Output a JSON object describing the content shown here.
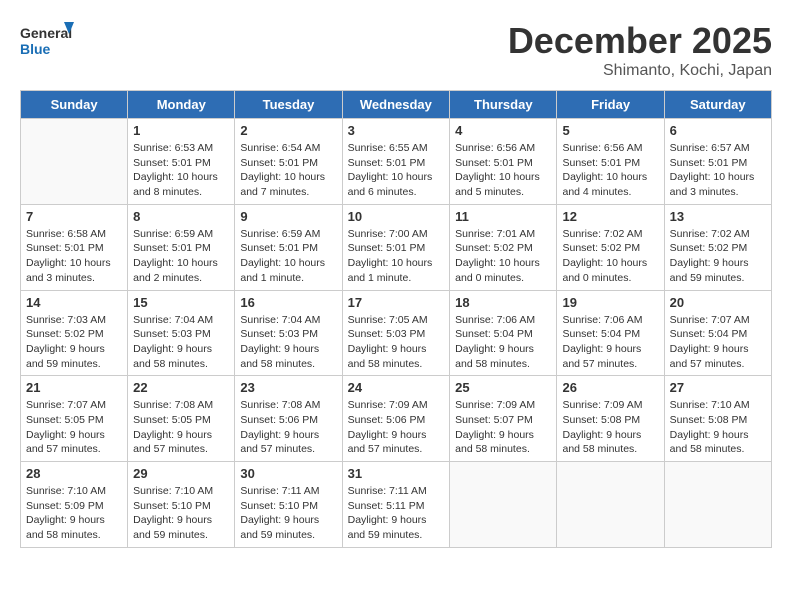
{
  "header": {
    "logo_line1": "General",
    "logo_line2": "Blue",
    "title": "December 2025",
    "subtitle": "Shimanto, Kochi, Japan"
  },
  "weekdays": [
    "Sunday",
    "Monday",
    "Tuesday",
    "Wednesday",
    "Thursday",
    "Friday",
    "Saturday"
  ],
  "weeks": [
    [
      {
        "day": "",
        "text": ""
      },
      {
        "day": "1",
        "text": "Sunrise: 6:53 AM\nSunset: 5:01 PM\nDaylight: 10 hours\nand 8 minutes."
      },
      {
        "day": "2",
        "text": "Sunrise: 6:54 AM\nSunset: 5:01 PM\nDaylight: 10 hours\nand 7 minutes."
      },
      {
        "day": "3",
        "text": "Sunrise: 6:55 AM\nSunset: 5:01 PM\nDaylight: 10 hours\nand 6 minutes."
      },
      {
        "day": "4",
        "text": "Sunrise: 6:56 AM\nSunset: 5:01 PM\nDaylight: 10 hours\nand 5 minutes."
      },
      {
        "day": "5",
        "text": "Sunrise: 6:56 AM\nSunset: 5:01 PM\nDaylight: 10 hours\nand 4 minutes."
      },
      {
        "day": "6",
        "text": "Sunrise: 6:57 AM\nSunset: 5:01 PM\nDaylight: 10 hours\nand 3 minutes."
      }
    ],
    [
      {
        "day": "7",
        "text": "Sunrise: 6:58 AM\nSunset: 5:01 PM\nDaylight: 10 hours\nand 3 minutes."
      },
      {
        "day": "8",
        "text": "Sunrise: 6:59 AM\nSunset: 5:01 PM\nDaylight: 10 hours\nand 2 minutes."
      },
      {
        "day": "9",
        "text": "Sunrise: 6:59 AM\nSunset: 5:01 PM\nDaylight: 10 hours\nand 1 minute."
      },
      {
        "day": "10",
        "text": "Sunrise: 7:00 AM\nSunset: 5:01 PM\nDaylight: 10 hours\nand 1 minute."
      },
      {
        "day": "11",
        "text": "Sunrise: 7:01 AM\nSunset: 5:02 PM\nDaylight: 10 hours\nand 0 minutes."
      },
      {
        "day": "12",
        "text": "Sunrise: 7:02 AM\nSunset: 5:02 PM\nDaylight: 10 hours\nand 0 minutes."
      },
      {
        "day": "13",
        "text": "Sunrise: 7:02 AM\nSunset: 5:02 PM\nDaylight: 9 hours\nand 59 minutes."
      }
    ],
    [
      {
        "day": "14",
        "text": "Sunrise: 7:03 AM\nSunset: 5:02 PM\nDaylight: 9 hours\nand 59 minutes."
      },
      {
        "day": "15",
        "text": "Sunrise: 7:04 AM\nSunset: 5:03 PM\nDaylight: 9 hours\nand 58 minutes."
      },
      {
        "day": "16",
        "text": "Sunrise: 7:04 AM\nSunset: 5:03 PM\nDaylight: 9 hours\nand 58 minutes."
      },
      {
        "day": "17",
        "text": "Sunrise: 7:05 AM\nSunset: 5:03 PM\nDaylight: 9 hours\nand 58 minutes."
      },
      {
        "day": "18",
        "text": "Sunrise: 7:06 AM\nSunset: 5:04 PM\nDaylight: 9 hours\nand 58 minutes."
      },
      {
        "day": "19",
        "text": "Sunrise: 7:06 AM\nSunset: 5:04 PM\nDaylight: 9 hours\nand 57 minutes."
      },
      {
        "day": "20",
        "text": "Sunrise: 7:07 AM\nSunset: 5:04 PM\nDaylight: 9 hours\nand 57 minutes."
      }
    ],
    [
      {
        "day": "21",
        "text": "Sunrise: 7:07 AM\nSunset: 5:05 PM\nDaylight: 9 hours\nand 57 minutes."
      },
      {
        "day": "22",
        "text": "Sunrise: 7:08 AM\nSunset: 5:05 PM\nDaylight: 9 hours\nand 57 minutes."
      },
      {
        "day": "23",
        "text": "Sunrise: 7:08 AM\nSunset: 5:06 PM\nDaylight: 9 hours\nand 57 minutes."
      },
      {
        "day": "24",
        "text": "Sunrise: 7:09 AM\nSunset: 5:06 PM\nDaylight: 9 hours\nand 57 minutes."
      },
      {
        "day": "25",
        "text": "Sunrise: 7:09 AM\nSunset: 5:07 PM\nDaylight: 9 hours\nand 58 minutes."
      },
      {
        "day": "26",
        "text": "Sunrise: 7:09 AM\nSunset: 5:08 PM\nDaylight: 9 hours\nand 58 minutes."
      },
      {
        "day": "27",
        "text": "Sunrise: 7:10 AM\nSunset: 5:08 PM\nDaylight: 9 hours\nand 58 minutes."
      }
    ],
    [
      {
        "day": "28",
        "text": "Sunrise: 7:10 AM\nSunset: 5:09 PM\nDaylight: 9 hours\nand 58 minutes."
      },
      {
        "day": "29",
        "text": "Sunrise: 7:10 AM\nSunset: 5:10 PM\nDaylight: 9 hours\nand 59 minutes."
      },
      {
        "day": "30",
        "text": "Sunrise: 7:11 AM\nSunset: 5:10 PM\nDaylight: 9 hours\nand 59 minutes."
      },
      {
        "day": "31",
        "text": "Sunrise: 7:11 AM\nSunset: 5:11 PM\nDaylight: 9 hours\nand 59 minutes."
      },
      {
        "day": "",
        "text": ""
      },
      {
        "day": "",
        "text": ""
      },
      {
        "day": "",
        "text": ""
      }
    ]
  ]
}
